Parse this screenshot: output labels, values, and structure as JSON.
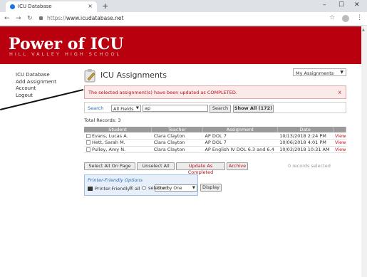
{
  "browser": {
    "tab_title": "ICU Database",
    "url_prefix": "https://",
    "url_main": "www.icudatabase.net"
  },
  "banner": {
    "logo": "Power of ICU",
    "subtitle": "HILL VALLEY HIGH SCHOOL"
  },
  "sidebar": {
    "items": [
      {
        "label": "ICU Database"
      },
      {
        "label": "Add Assignment"
      },
      {
        "label": "Account"
      },
      {
        "label": "Logout"
      }
    ]
  },
  "page": {
    "title": "ICU Assignments",
    "view_select": "My Assignments"
  },
  "alert": {
    "message": "The selected assignment(s) have been updated as COMPLETED.",
    "close": "X"
  },
  "search": {
    "label": "Search",
    "field_select": "All Fields",
    "query": "ap",
    "search_button": "Search",
    "show_all_button": "Show All (172)"
  },
  "total_records": "Total Records: 3",
  "table": {
    "headers": [
      "Student",
      "Teacher",
      "Assignment",
      "Date",
      ""
    ],
    "rows": [
      {
        "student": "Evans, Lucas A.",
        "teacher": "Clara Clayton",
        "assignment": "AP DOL 7",
        "date": "10/13/2018 2:24 PM",
        "action": "View"
      },
      {
        "student": "Hett, Sarah M.",
        "teacher": "Clara Clayton",
        "assignment": "AP DOL 7",
        "date": "10/06/2018 4:01 PM",
        "action": "View"
      },
      {
        "student": "Pulley, Amy N.",
        "teacher": "Clara Clayton",
        "assignment": "AP English IV DOL 6.3 and 6.4",
        "date": "10/03/2018 10:31 AM",
        "action": "View"
      }
    ]
  },
  "actions": {
    "select_all": "Select All On Page",
    "unselect_all": "Unselect All",
    "update_completed": "Update As Completed",
    "archive": "Archive",
    "records_selected": "0 records selected"
  },
  "printer": {
    "title": "Printer-Friendly Options",
    "label": "Printer-Friendly",
    "opt_all": "all",
    "opt_selected": "selected",
    "mode_select": "One by One",
    "display_button": "Display"
  }
}
